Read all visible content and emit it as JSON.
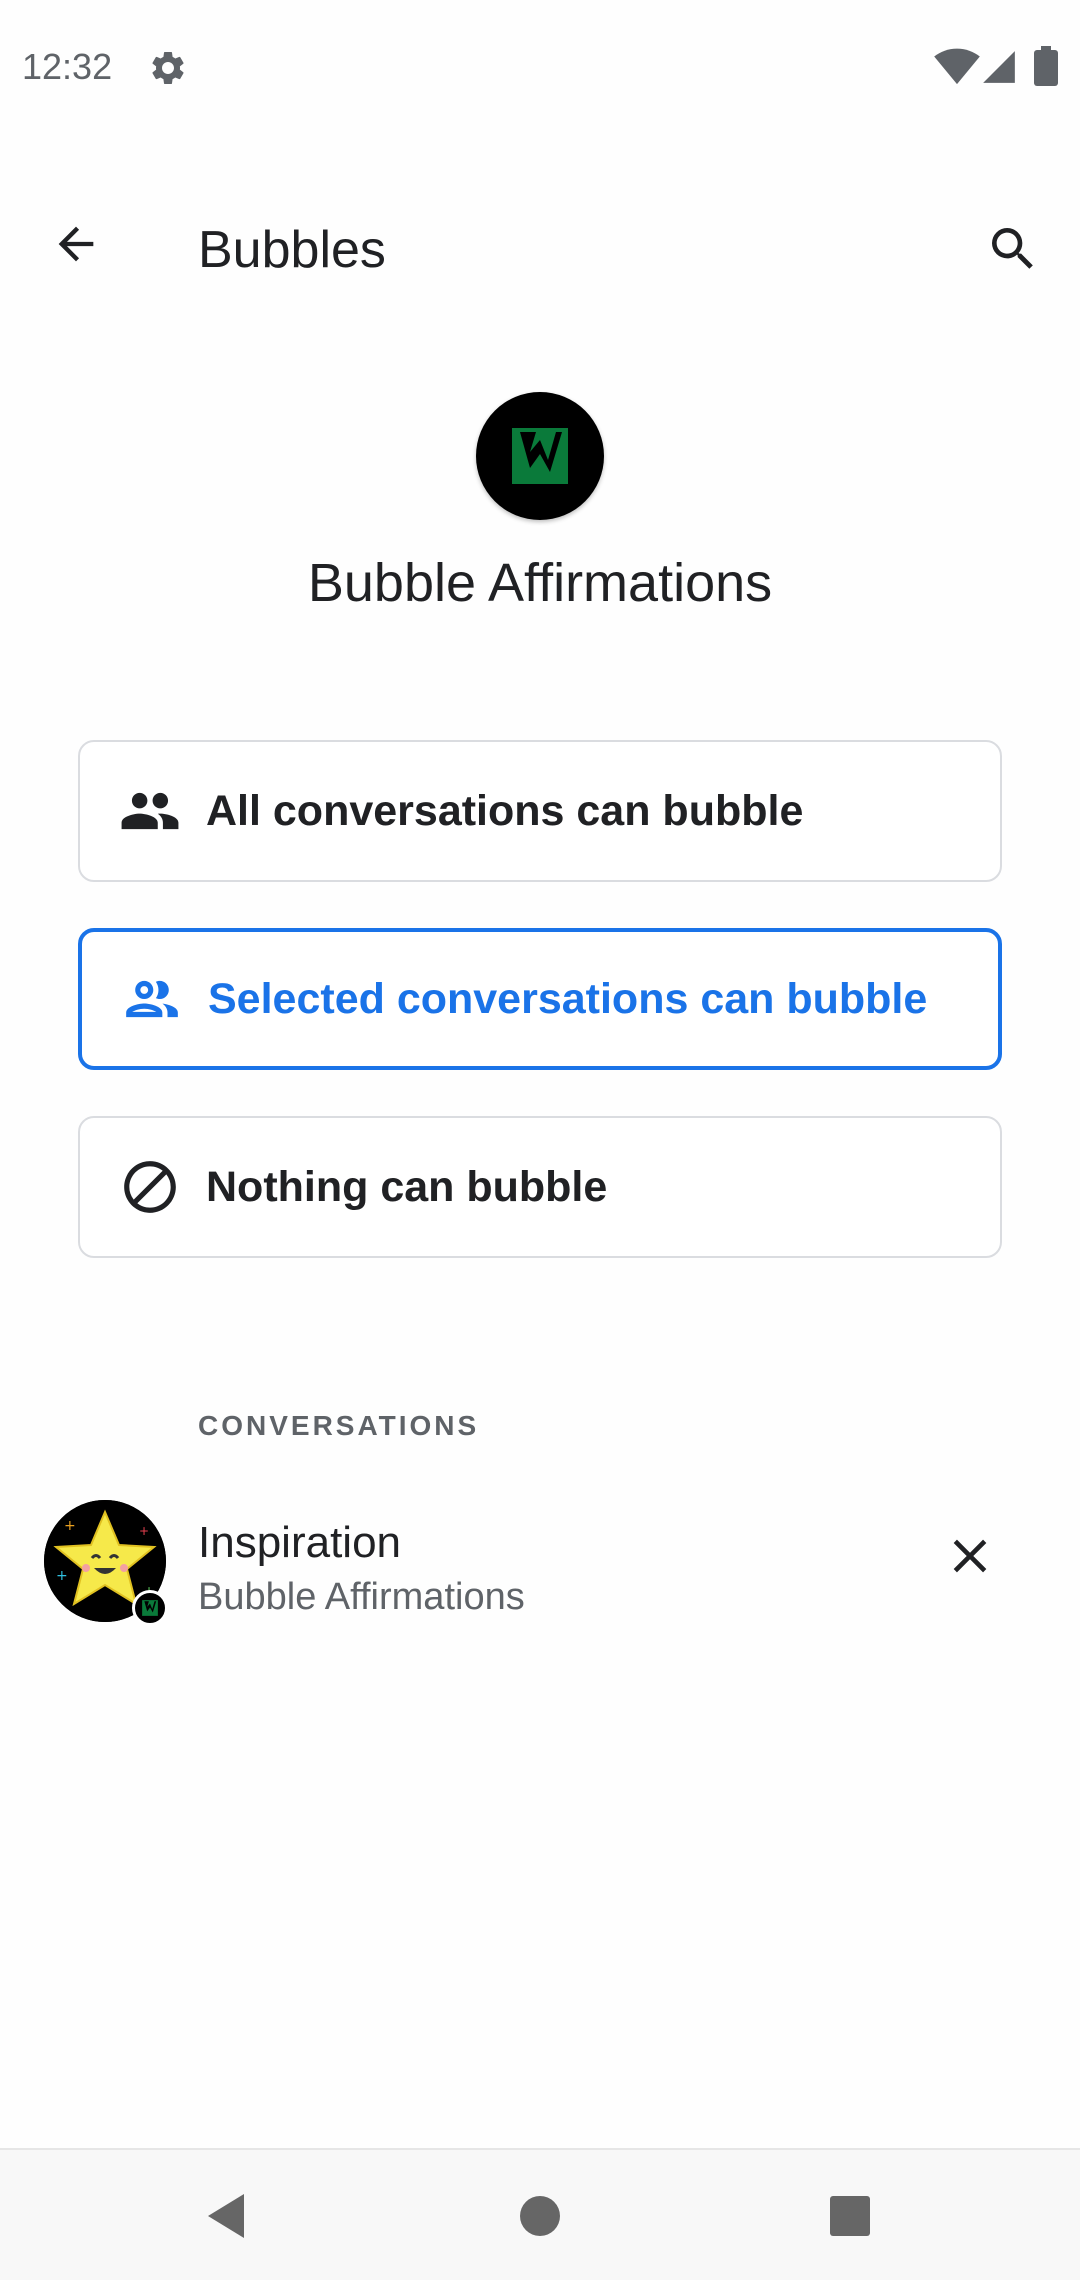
{
  "status_bar": {
    "time": "12:32"
  },
  "app_bar": {
    "title": "Bubbles"
  },
  "app_header": {
    "app_name": "Bubble Affirmations"
  },
  "bubble_options": [
    {
      "label": "All conversations can bubble",
      "selected": false,
      "icon": "people-icon"
    },
    {
      "label": "Selected conversations can bubble",
      "selected": true,
      "icon": "people-outline-icon"
    },
    {
      "label": "Nothing can bubble",
      "selected": false,
      "icon": "block-icon"
    }
  ],
  "conversations": {
    "header": "CONVERSATIONS",
    "items": [
      {
        "title": "Inspiration",
        "subtitle": "Bubble Affirmations"
      }
    ]
  },
  "colors": {
    "accent": "#1a73e8",
    "text_primary": "#202124",
    "text_secondary": "#5f6368",
    "border": "#dadce0",
    "app_icon_green": "#0a7a3a"
  }
}
